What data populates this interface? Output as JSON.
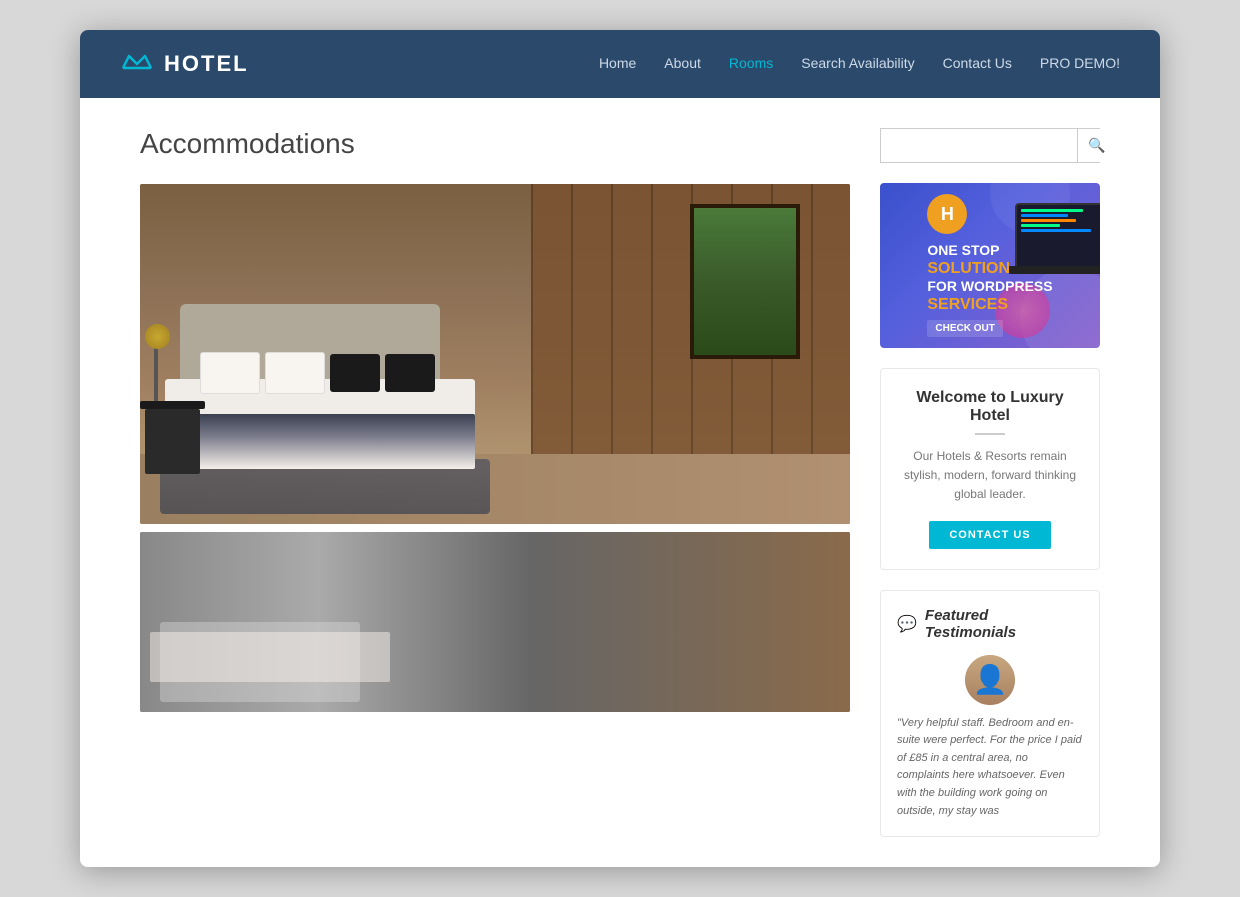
{
  "site": {
    "title": "HOTEL"
  },
  "navbar": {
    "brand": "HOTEL",
    "nav_items": [
      {
        "label": "Home",
        "active": false
      },
      {
        "label": "About",
        "active": false
      },
      {
        "label": "Rooms",
        "active": true
      },
      {
        "label": "Search Availability",
        "active": false
      },
      {
        "label": "Contact Us",
        "active": false
      },
      {
        "label": "PRO DEMO!",
        "active": false
      }
    ]
  },
  "main": {
    "page_title": "Accommodations"
  },
  "search": {
    "placeholder": ""
  },
  "ad": {
    "badge_text": "H",
    "line1": "ONE STOP",
    "line2": "SOLUTION",
    "line3": "FOR WORDPRESS",
    "line4": "SERVICES",
    "cta": "CHECK OUT"
  },
  "welcome": {
    "title": "Welcome to Luxury Hotel",
    "body": "Our Hotels & Resorts remain stylish, modern, forward thinking global leader.",
    "cta": "CONTACT US"
  },
  "testimonials": {
    "title": "Featured Testimonials",
    "quote": "\"Very helpful staff. Bedroom and en-suite were perfect. For the price I paid of £85 in a central area, no complaints here whatsoever. Even with the building work going on outside, my stay was"
  }
}
